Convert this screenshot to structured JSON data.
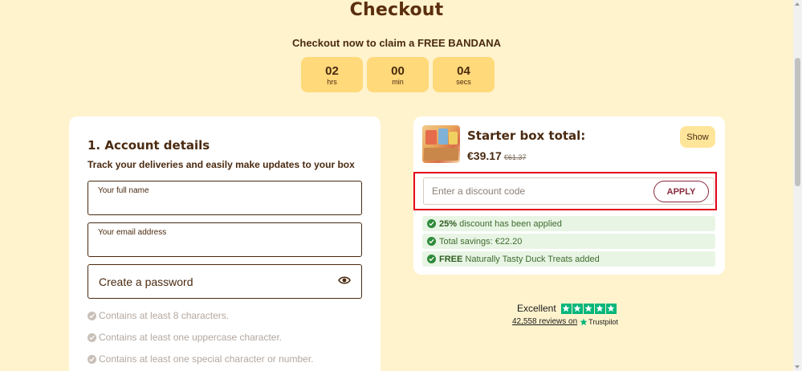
{
  "header": {
    "title": "Checkout",
    "claim_prefix": "Checkout now to claim a ",
    "claim_bold": "FREE BANDANA"
  },
  "timer": [
    {
      "value": "02",
      "unit": "hrs"
    },
    {
      "value": "00",
      "unit": "min"
    },
    {
      "value": "04",
      "unit": "secs"
    }
  ],
  "account": {
    "title": "1. Account details",
    "subtitle": "Track your deliveries and easily make updates to your box",
    "full_name_label": "Your full name",
    "email_label": "Your email address",
    "password_placeholder": "Create a password",
    "rules": [
      "Contains at least 8 characters.",
      "Contains at least one uppercase character.",
      "Contains at least one special character or number."
    ]
  },
  "summary": {
    "box_title": "Starter box total:",
    "price": "€39.17",
    "old_price": "€61.37",
    "show_label": "Show",
    "discount_placeholder": "Enter a discount code",
    "apply_label": "APPLY",
    "badges": [
      {
        "bold": "25%",
        "text": " discount has been applied"
      },
      {
        "bold": "",
        "text": "Total savings: €22.20"
      },
      {
        "bold": "FREE",
        "text": " Naturally Tasty Duck Treats added"
      }
    ]
  },
  "trustpilot": {
    "rating_word": "Excellent",
    "reviews_link": "42,558 reviews on",
    "brand": "Trustpilot",
    "stars": 5
  },
  "colors": {
    "background": "#fff3cd",
    "timer_box": "#ffd97a",
    "apply_accent": "#8b2a3e",
    "highlight_border": "#e3001b",
    "success_bg": "#e8f5e4",
    "success_green": "#2e8b3a",
    "trustpilot_green": "#00b67a"
  }
}
